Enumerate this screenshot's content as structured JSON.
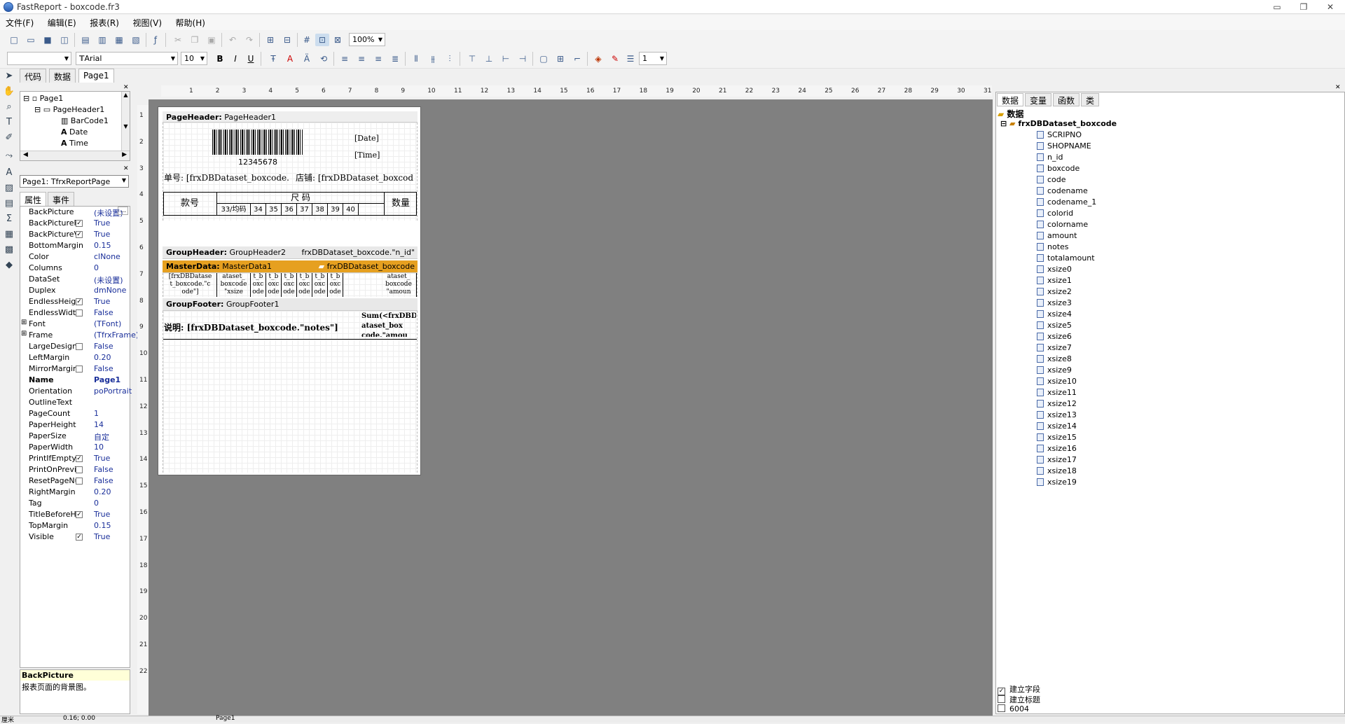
{
  "title": "FastReport - boxcode.fr3",
  "window_controls": {
    "minimize": "▭",
    "restore": "❐",
    "close": "✕"
  },
  "menu": [
    "文件(F)",
    "编辑(E)",
    "报表(R)",
    "视图(V)",
    "帮助(H)"
  ],
  "toolbar1": {
    "zoom": "100%"
  },
  "toolbar2": {
    "style": "",
    "font": "Arial",
    "font_size": "10",
    "bold": "B",
    "italic": "I",
    "underline": "U",
    "frame_width": "1"
  },
  "left_tabs": [
    "代码",
    "数据",
    "Page1"
  ],
  "tree": [
    {
      "label": "Page1"
    },
    {
      "label": "PageHeader1"
    },
    {
      "label": "BarCode1"
    },
    {
      "label": "Date"
    },
    {
      "label": "Time"
    }
  ],
  "page_combo": "Page1: TfrxReportPage",
  "inspector_tabs": [
    "属性",
    "事件"
  ],
  "properties": [
    {
      "name": "BackPicture",
      "value": "(未设置)"
    },
    {
      "name": "BackPicturePr",
      "value": "True",
      "check": true
    },
    {
      "name": "BackPictureVi",
      "value": "True",
      "check": true
    },
    {
      "name": "BottomMargin",
      "value": "0.15"
    },
    {
      "name": "Color",
      "value": "clNone"
    },
    {
      "name": "Columns",
      "value": "0"
    },
    {
      "name": "DataSet",
      "value": "(未设置)"
    },
    {
      "name": "Duplex",
      "value": "dmNone"
    },
    {
      "name": "EndlessHeigh",
      "value": "True",
      "check": true
    },
    {
      "name": "EndlessWidth",
      "value": "False",
      "check": false
    },
    {
      "name": "Font",
      "value": "(TFont)"
    },
    {
      "name": "Frame",
      "value": "(TfrxFrame)"
    },
    {
      "name": "LargeDesignH",
      "value": "False",
      "check": false
    },
    {
      "name": "LeftMargin",
      "value": "0.20"
    },
    {
      "name": "MirrorMargins",
      "value": "False",
      "check": false
    },
    {
      "name": "Name",
      "value": "Page1",
      "bold": true
    },
    {
      "name": "Orientation",
      "value": "poPortrait"
    },
    {
      "name": "OutlineText",
      "value": ""
    },
    {
      "name": "PageCount",
      "value": "1"
    },
    {
      "name": "PaperHeight",
      "value": "14"
    },
    {
      "name": "PaperSize",
      "value": "自定"
    },
    {
      "name": "PaperWidth",
      "value": "10"
    },
    {
      "name": "PrintIfEmpty",
      "value": "True",
      "check": true
    },
    {
      "name": "PrintOnPrevic",
      "value": "False",
      "check": false
    },
    {
      "name": "ResetPageNu",
      "value": "False",
      "check": false
    },
    {
      "name": "RightMargin",
      "value": "0.20"
    },
    {
      "name": "Tag",
      "value": "0"
    },
    {
      "name": "TitleBeforeHe",
      "value": "True",
      "check": true
    },
    {
      "name": "TopMargin",
      "value": "0.15"
    },
    {
      "name": "Visible",
      "value": "True",
      "check": true
    }
  ],
  "desc": {
    "title": "BackPicture",
    "text": "报表页面的背景图。"
  },
  "ruler_h": [
    "1",
    "2",
    "3",
    "4",
    "5",
    "6",
    "7",
    "8",
    "9",
    "10",
    "11",
    "12",
    "13",
    "14",
    "15",
    "16",
    "17",
    "18",
    "19",
    "20",
    "21",
    "22",
    "23",
    "24",
    "25",
    "26",
    "27",
    "28",
    "29",
    "30",
    "31"
  ],
  "ruler_v": [
    "1",
    "2",
    "3",
    "4",
    "5",
    "6",
    "7",
    "8",
    "9",
    "10",
    "11",
    "12",
    "13",
    "14",
    "15",
    "16",
    "17",
    "18",
    "19",
    "20",
    "21",
    "22"
  ],
  "report": {
    "page_header": {
      "label": "PageHeader:",
      "name": "PageHeader1"
    },
    "barcode_text": "12345678",
    "date": "[Date]",
    "time": "[Time]",
    "order_no": "单号: [frxDBDataset_boxcode.",
    "shop": "店铺: [frxDBDataset_boxcod",
    "col_style": "款号",
    "col_size": "尺    码",
    "col_qty": "数量",
    "sizes": [
      "33/均码",
      "34",
      "35",
      "36",
      "37",
      "38",
      "39",
      "40"
    ],
    "group_header": {
      "label": "GroupHeader:",
      "name": "GroupHeader2",
      "expr": "frxDBDataset_boxcode.\"n_id\""
    },
    "master_data": {
      "label": "MasterData:",
      "name": "MasterData1",
      "ds": "frxDBDataset_boxcode"
    },
    "master_cells": [
      "[frxDBDatase t_boxcode.\"c ode\"]",
      "ataset_ boxcode \"xsize",
      "t_b oxc ode",
      "t_b oxc ode",
      "t_b oxc ode",
      "t_b oxc ode",
      "t_b oxc ode",
      "t_b oxc ode",
      "ataset_ boxcode \"amoun"
    ],
    "group_footer": {
      "label": "GroupFooter:",
      "name": "GroupFooter1"
    },
    "notes": "说明: [frxDBDataset_boxcode.\"notes\"]",
    "sum": "Sum(<frxDBD ataset_box code.\"amou"
  },
  "right_tabs": [
    "数据",
    "变量",
    "函数",
    "类"
  ],
  "data_root": "数据",
  "dataset": "frxDBDataset_boxcode",
  "fields": [
    "SCRIPNO",
    "SHOPNAME",
    "n_id",
    "boxcode",
    "code",
    "codename",
    "codename_1",
    "colorid",
    "colorname",
    "amount",
    "notes",
    "totalamount",
    "xsize0",
    "xsize1",
    "xsize2",
    "xsize3",
    "xsize4",
    "xsize5",
    "xsize6",
    "xsize7",
    "xsize8",
    "xsize9",
    "xsize10",
    "xsize11",
    "xsize12",
    "xsize13",
    "xsize14",
    "xsize15",
    "xsize16",
    "xsize17",
    "xsize18",
    "xsize19"
  ],
  "options": [
    {
      "label": "建立字段",
      "checked": true
    },
    {
      "label": "建立标题",
      "checked": false
    },
    {
      "label": "6004",
      "checked": false
    }
  ],
  "status": {
    "units": "厘米",
    "pos": "0.16; 0.00",
    "page": "Page1"
  },
  "colors": {
    "masterdata_band": "#e6a020",
    "design_bg": "#808080"
  }
}
